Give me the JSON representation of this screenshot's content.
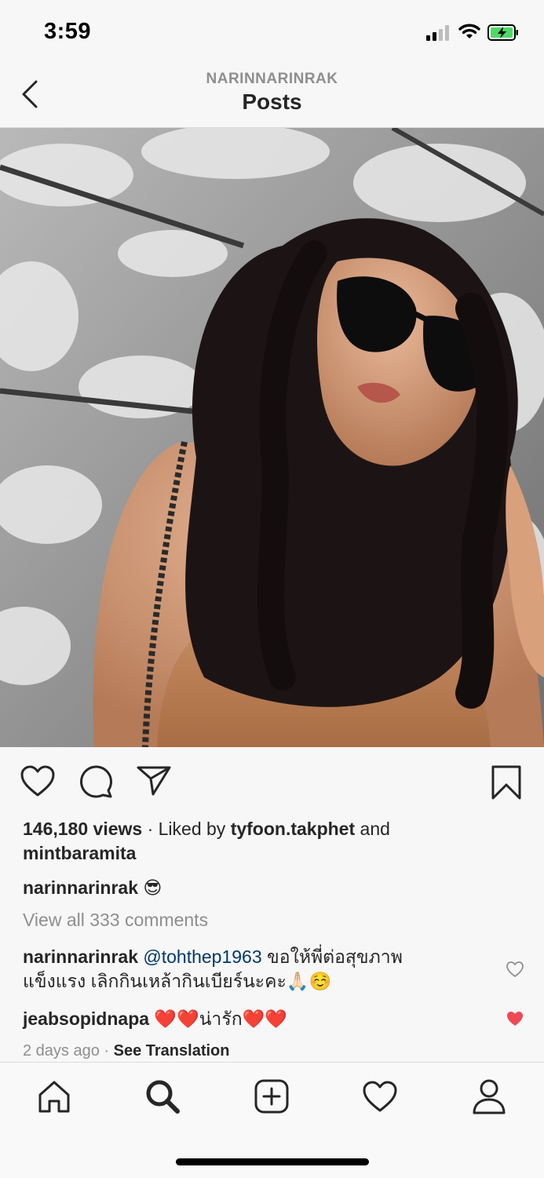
{
  "status_bar": {
    "time": "3:59",
    "icons": [
      "cellular-signal-icon",
      "wifi-icon",
      "battery-charging-icon"
    ],
    "battery_color": "#4cd964"
  },
  "header": {
    "username": "NARINNARINRAK",
    "title": "Posts",
    "back_icon": "chevron-left-icon"
  },
  "post": {
    "image": "photo of a woman with long dark hair wearing black sunglasses against a sunlit wall",
    "actions": {
      "icons": [
        "heart-icon",
        "comment-icon",
        "share-icon",
        "bookmark-icon"
      ]
    },
    "views": "146,180 views",
    "liked_prefix": " · Liked by ",
    "liked_user_1": "tyfoon.takphet",
    "liked_and": " and",
    "liked_user_2": "mintbaramita",
    "caption_user": "narinnarinrak",
    "caption_text": " 😎",
    "view_all_comments": "View all 333 comments",
    "comments": [
      {
        "user": "narinnarinrak",
        "mention": "@tohthep1963",
        "text_line1": " ขอให้พี่ต่อสุขภาพ",
        "text_line2": "แข็งแรง เลิกกินเหล้ากินเบียร์นะคะ🙏🏻☺️",
        "liked": false
      },
      {
        "user": "jeabsopidnapa",
        "text": " ❤️❤️น่ารัก❤️❤️",
        "liked": true
      }
    ],
    "timestamp": "2 days ago",
    "timestamp_sep": " · ",
    "see_translation": "See Translation",
    "like_color": "#ed4956"
  },
  "tab_bar": {
    "items": [
      "home-icon",
      "search-icon",
      "new-post-icon",
      "activity-icon",
      "profile-icon"
    ]
  }
}
